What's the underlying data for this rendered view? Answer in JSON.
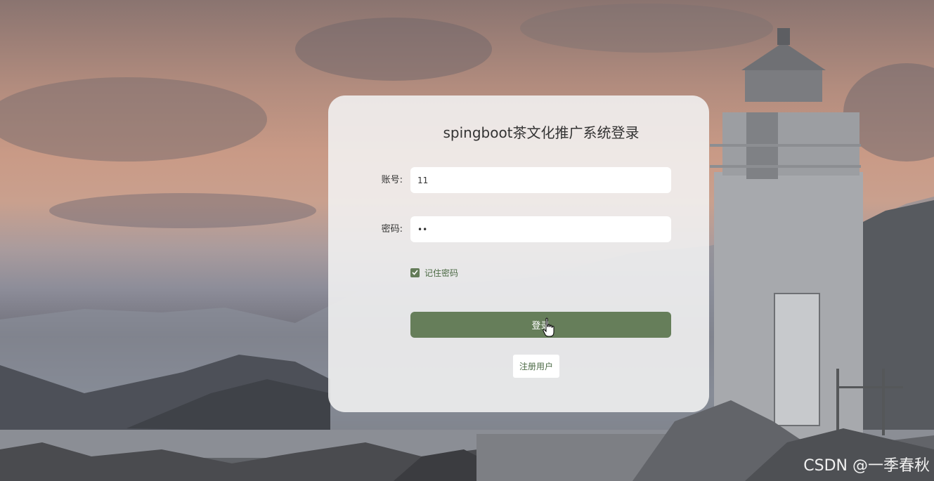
{
  "login": {
    "title": "spingboot茶文化推广系统登录",
    "account_label": "账号:",
    "account_value": "11",
    "password_label": "密码:",
    "password_value": "••",
    "remember_label": "记住密码",
    "remember_checked": true,
    "login_button_label": "登录",
    "register_button_label": "注册用户"
  },
  "watermark": "CSDN @一季春秋",
  "colors": {
    "primary_green": "#667e5a",
    "text_green": "#4d6b46",
    "card_background": "#f3f3f3"
  },
  "icons": {
    "checkbox": "check-icon",
    "cursor": "hand-pointer-icon"
  }
}
